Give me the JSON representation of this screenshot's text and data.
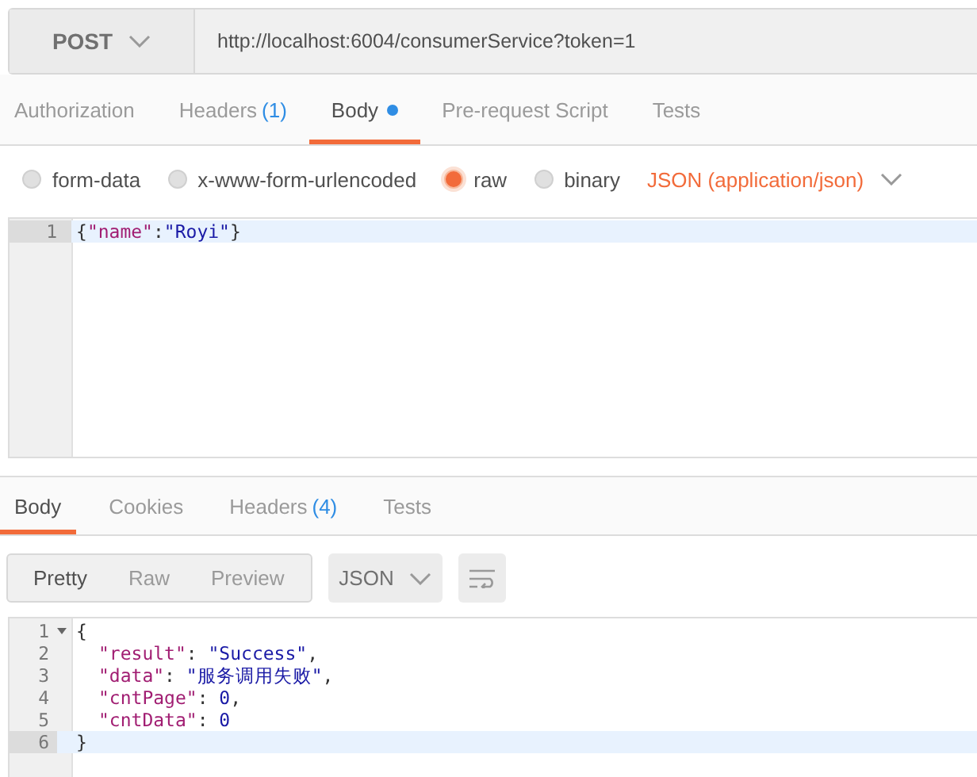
{
  "request": {
    "method": "POST",
    "url": "http://localhost:6004/consumerService?token=1"
  },
  "request_tabs": [
    {
      "label": "Authorization",
      "dot": false,
      "selected": false
    },
    {
      "label": "Headers",
      "count": "(1)",
      "dot": false,
      "selected": false
    },
    {
      "label": "Body",
      "dot": true,
      "selected": true
    },
    {
      "label": "Pre-request Script",
      "dot": false,
      "selected": false
    },
    {
      "label": "Tests",
      "dot": false,
      "selected": false
    }
  ],
  "body_types": [
    {
      "label": "form-data",
      "selected": false
    },
    {
      "label": "x-www-form-urlencoded",
      "selected": false
    },
    {
      "label": "raw",
      "selected": true
    },
    {
      "label": "binary",
      "selected": false
    }
  ],
  "content_type": "JSON (application/json)",
  "request_editor": {
    "lines": [
      {
        "number": "1",
        "active": true,
        "segments": [
          {
            "kind": "punct",
            "text": "{"
          },
          {
            "kind": "key",
            "text": "\"name\""
          },
          {
            "kind": "punct",
            "text": ":"
          },
          {
            "kind": "string",
            "text": "\"Royi\""
          },
          {
            "kind": "punct",
            "text": "}"
          }
        ]
      }
    ]
  },
  "response_tabs": [
    {
      "label": "Body",
      "selected": true
    },
    {
      "label": "Cookies",
      "selected": false
    },
    {
      "label": "Headers",
      "count": "(4)",
      "selected": false
    },
    {
      "label": "Tests",
      "selected": false
    }
  ],
  "view_modes": [
    {
      "label": "Pretty",
      "selected": true
    },
    {
      "label": "Raw",
      "selected": false
    },
    {
      "label": "Preview",
      "selected": false
    }
  ],
  "format": "JSON",
  "response_editor": {
    "lines": [
      {
        "number": "1",
        "kind": "brace",
        "active": false,
        "fold": true,
        "segments": [
          {
            "kind": "punct",
            "text": "{"
          }
        ]
      },
      {
        "number": "2",
        "kind": "member",
        "active": false,
        "fold": false,
        "segments": [
          {
            "kind": "key",
            "text": "\"result\""
          },
          {
            "kind": "punct",
            "text": ": "
          },
          {
            "kind": "string",
            "text": "\"Success\""
          },
          {
            "kind": "punct",
            "text": ","
          }
        ]
      },
      {
        "number": "3",
        "kind": "member",
        "active": false,
        "fold": false,
        "segments": [
          {
            "kind": "key",
            "text": "\"data\""
          },
          {
            "kind": "punct",
            "text": ": "
          },
          {
            "kind": "string",
            "text": "\"服务调用失败\""
          },
          {
            "kind": "punct",
            "text": ","
          }
        ]
      },
      {
        "number": "4",
        "kind": "member",
        "active": false,
        "fold": false,
        "segments": [
          {
            "kind": "key",
            "text": "\"cntPage\""
          },
          {
            "kind": "punct",
            "text": ": "
          },
          {
            "kind": "number",
            "text": "0"
          },
          {
            "kind": "punct",
            "text": ","
          }
        ]
      },
      {
        "number": "5",
        "kind": "member",
        "active": false,
        "fold": false,
        "segments": [
          {
            "kind": "key",
            "text": "\"cntData\""
          },
          {
            "kind": "punct",
            "text": ": "
          },
          {
            "kind": "number",
            "text": "0"
          }
        ]
      },
      {
        "number": "6",
        "kind": "brace",
        "active": true,
        "fold": false,
        "segments": [
          {
            "kind": "punct",
            "text": "}"
          }
        ]
      }
    ]
  }
}
